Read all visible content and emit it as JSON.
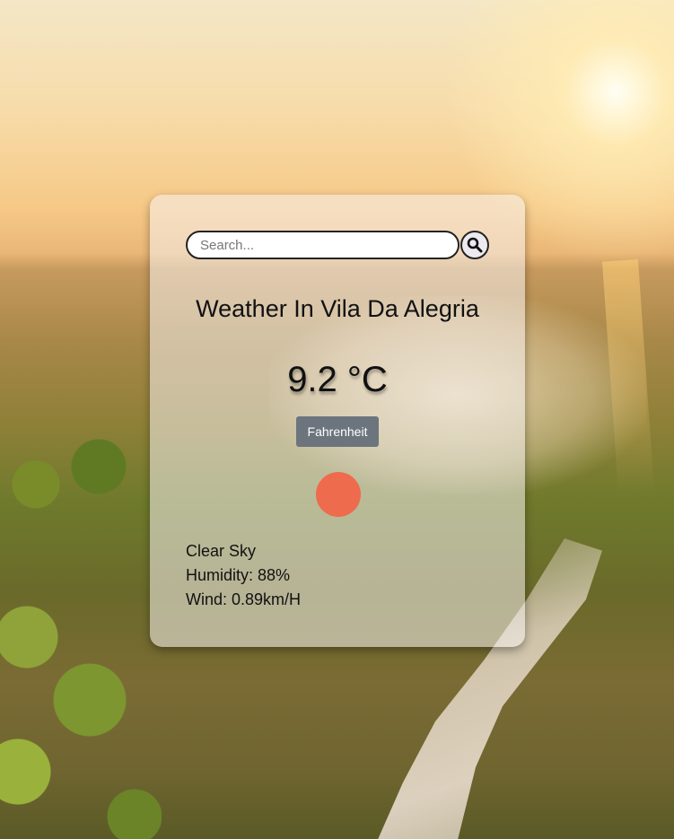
{
  "search": {
    "placeholder": "Search...",
    "value": "",
    "button_icon": "search-icon"
  },
  "weather": {
    "title": "Weather In Vila Da Alegria",
    "temperature": "9.2 °C",
    "unit_toggle_label": "Fahrenheit",
    "icon": "sun-icon",
    "icon_color": "#ee6b4d",
    "description": "Clear Sky",
    "humidity": "Humidity: 88%",
    "wind": "Wind: 0.89km/H"
  },
  "colors": {
    "button_bg": "#6c757d",
    "card_bg": "rgba(245,240,238,0.55)"
  }
}
